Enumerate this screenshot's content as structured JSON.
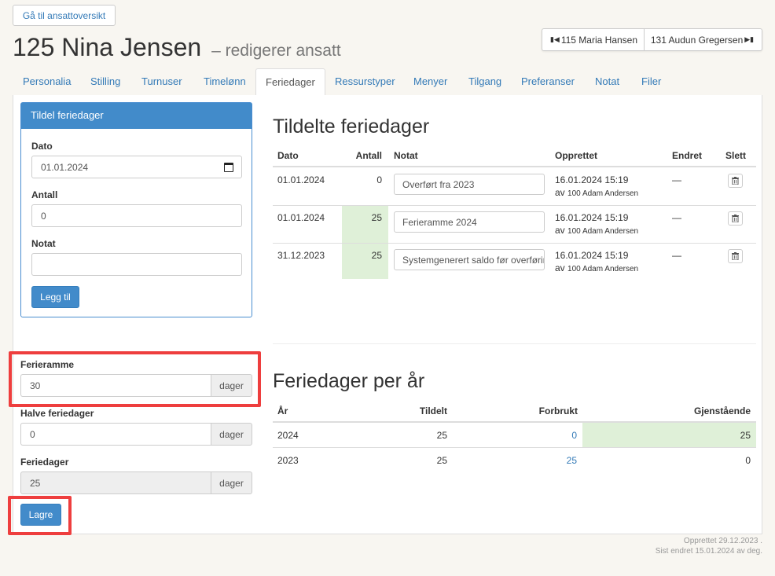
{
  "header": {
    "back_label": "Gå til ansattoversikt",
    "title": "125 Nina Jensen",
    "subtitle": "– redigerer ansatt",
    "prev_employee": "115 Maria Hansen",
    "next_employee": "131 Audun Gregersen"
  },
  "tabs": [
    "Personalia",
    "Stilling",
    "Turnuser",
    "Timelønn",
    "Feriedager",
    "Ressurstyper",
    "Menyer",
    "Tilgang",
    "Preferanser",
    "Notat",
    "Filer"
  ],
  "assign_panel": {
    "title": "Tildel feriedager",
    "date_label": "Dato",
    "date_value": "01.01.2024",
    "amount_label": "Antall",
    "amount_value": "0",
    "note_label": "Notat",
    "note_value": "",
    "add_button": "Legg til"
  },
  "settings": {
    "frame_label": "Ferieramme",
    "frame_value": "30",
    "half_label": "Halve feriedager",
    "half_value": "0",
    "days_label": "Feriedager",
    "days_value": "25",
    "unit": "dager",
    "save_button": "Lagre"
  },
  "assigned": {
    "heading": "Tildelte feriedager",
    "columns": [
      "Dato",
      "Antall",
      "Notat",
      "Opprettet",
      "Endret",
      "Slett"
    ],
    "rows": [
      {
        "date": "01.01.2024",
        "amount": "0",
        "note": "Overført fra 2023",
        "created": "16.01.2024 15:19",
        "by_prefix": "av",
        "by": "100 Adam Andersen",
        "changed": "—"
      },
      {
        "date": "01.01.2024",
        "amount": "25",
        "note": "Ferieramme 2024",
        "created": "16.01.2024 15:19",
        "by_prefix": "av",
        "by": "100 Adam Andersen",
        "changed": "—"
      },
      {
        "date": "31.12.2023",
        "amount": "25",
        "note": "Systemgenerert saldo før overføring",
        "created": "16.01.2024 15:19",
        "by_prefix": "av",
        "by": "100 Adam Andersen",
        "changed": "—"
      }
    ]
  },
  "per_year": {
    "heading": "Feriedager per år",
    "columns": [
      "År",
      "Tildelt",
      "Forbrukt",
      "Gjenstående"
    ],
    "rows": [
      {
        "year": "2024",
        "assigned": "25",
        "used": "0",
        "remaining": "25"
      },
      {
        "year": "2023",
        "assigned": "25",
        "used": "25",
        "remaining": "0"
      }
    ]
  },
  "footer": {
    "created": "Opprettet 29.12.2023 .",
    "changed": "Sist endret 15.01.2024 av deg."
  },
  "colors": {
    "primary": "#428bca",
    "link": "#337ab7",
    "highlight_green": "#dff0d8",
    "annotation_red": "#ee3e3e"
  }
}
